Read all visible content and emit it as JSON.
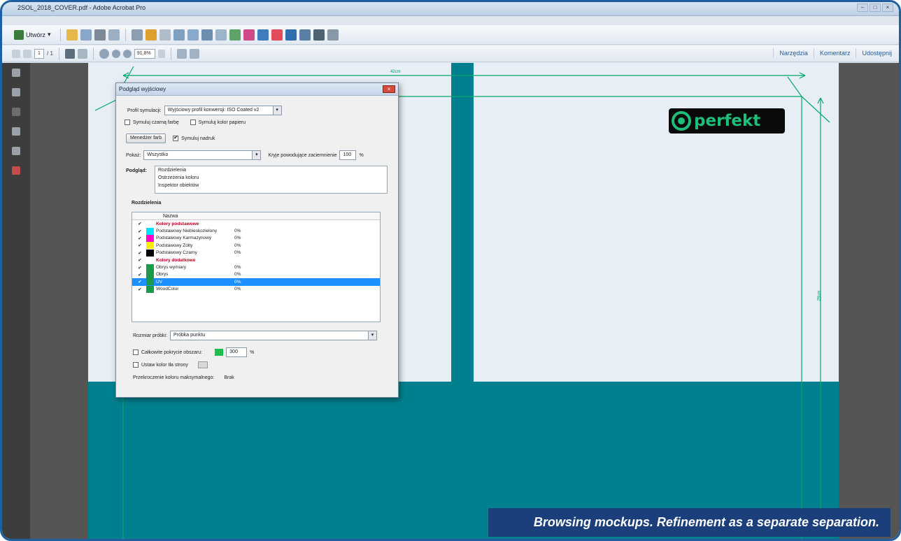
{
  "window": {
    "title": "2SOL_2018_COVER.pdf - Adobe Acrobat Pro",
    "controls": [
      "–",
      "□",
      "×"
    ]
  },
  "toolbar": {
    "create_label": "Utwórz",
    "page_current": "1",
    "page_total": "/ 1",
    "zoom": "91,8%",
    "tabs": [
      "Narzędzia",
      "Komentarz",
      "Udostępnij"
    ]
  },
  "document": {
    "logo_text": "perfekt",
    "width_label": "42cm",
    "height_label": "29cm",
    "colors": {
      "teal": "#00808e",
      "guide": "#00a86b"
    }
  },
  "dialog": {
    "title": "Podgląd wyjściowy",
    "close": "×",
    "profile_label": "Profil symulacji:",
    "profile_value": "Wyjściowy profil konwersji: ISO Coated v2",
    "simulate_black_ink": "Symuluj czarną farbę",
    "simulate_paper": "Symuluj kolor papieru",
    "ink_manager": "Menedżer farb",
    "simulate_overprint": "Symuluj nadruk",
    "show_label": "Pokaż:",
    "show_value": "Wszystko",
    "warn_label": "Kryje powodujące zaciemnienie",
    "warn_value": "100",
    "warn_unit": "%",
    "preview_label": "Podgląd:",
    "preview_items": [
      "Rozdzielenia",
      "Ostrzeżenia koloru",
      "Inspektor obiektów"
    ],
    "separations_label": "Rozdzielenia",
    "separations_header": "Nazwa",
    "separations": [
      {
        "checked": "✔",
        "name": "Kolory podstawowe",
        "pct": "",
        "swatch": "",
        "group": true
      },
      {
        "checked": "✔",
        "name": "Podstawowy Niebieskozielony",
        "pct": "0%",
        "swatch": "#00e5ff",
        "group": false
      },
      {
        "checked": "✔",
        "name": "Podstawowy Karmazynowy",
        "pct": "0%",
        "swatch": "#ff00cc",
        "group": false
      },
      {
        "checked": "✔",
        "name": "Podstawowy Żółty",
        "pct": "0%",
        "swatch": "#ffee00",
        "group": false
      },
      {
        "checked": "✔",
        "name": "Podstawowy Czarny",
        "pct": "0%",
        "swatch": "#000000",
        "group": false
      },
      {
        "checked": "✔",
        "name": "Kolory dodatkowe",
        "pct": "",
        "swatch": "",
        "group": true
      },
      {
        "checked": "✔",
        "name": "Obrys wymiary",
        "pct": "0%",
        "swatch": "#1a9a4a",
        "group": false
      },
      {
        "checked": "✔",
        "name": "Obrys",
        "pct": "0%",
        "swatch": "#1a9a4a",
        "group": false
      },
      {
        "checked": "✔",
        "name": "UV",
        "pct": "0%",
        "swatch": "#1a9a4a",
        "group": false,
        "selected": true
      },
      {
        "checked": "✔",
        "name": "WoodColor",
        "pct": "0%",
        "swatch": "#1a9a4a",
        "group": false
      }
    ],
    "sample_label": "Rozmiar próbki:",
    "sample_value": "Próbka punktu",
    "coverage_label": "Całkowite pokrycie obszaru:",
    "coverage_value": "300",
    "coverage_unit": "%",
    "bg_label": "Ustaw kolor tła strony",
    "max_label": "Przekroczenie koloru maksymalnego:",
    "max_value": "Brak"
  },
  "caption": "Browsing mockups. Refinement as a separate separation."
}
